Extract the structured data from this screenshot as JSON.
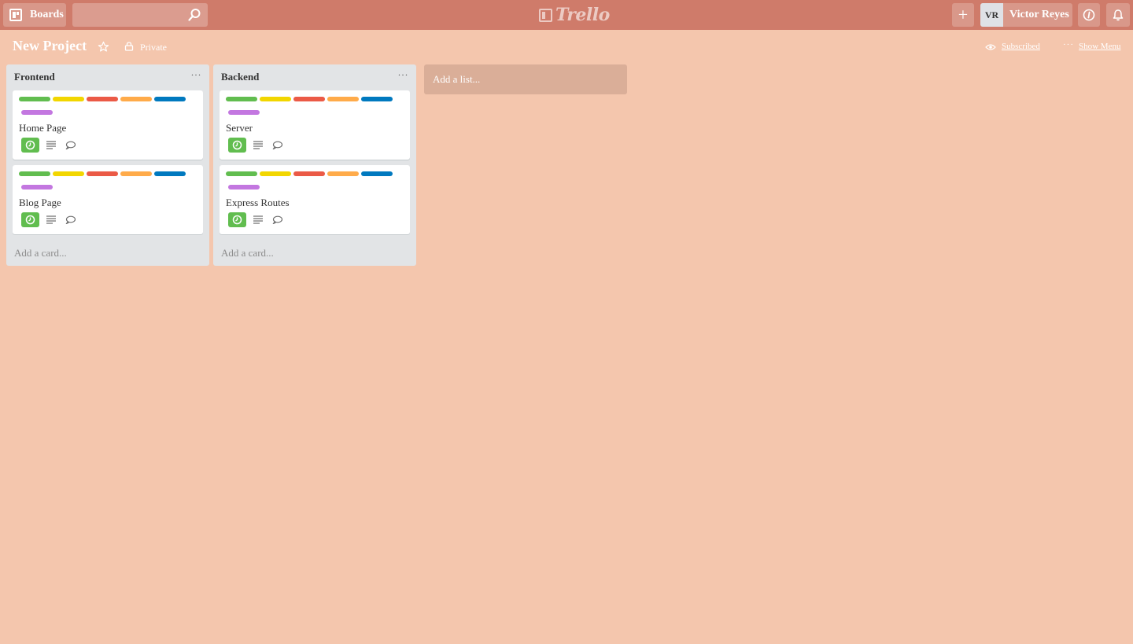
{
  "header": {
    "boards_label": "Boards",
    "search_placeholder": "",
    "logo_text": "Trello",
    "add_symbol": "+",
    "user_initials": "VR",
    "user_name": "Victor Reyes"
  },
  "board": {
    "title": "New Project",
    "privacy": "Private",
    "subscribed_label": "Subscribed",
    "menu_dots": "···",
    "show_menu_label": "Show Menu"
  },
  "colors": {
    "header_bg": "#cf7b6a",
    "board_bg": "#f4c6ad",
    "label_colors": [
      "#61bd4f",
      "#f2d600",
      "#eb5a46",
      "#ffab4a",
      "#0079bf",
      "#c377e0"
    ],
    "due_badge": "#61bd4f"
  },
  "lists": [
    {
      "title": "Frontend",
      "menu": "···",
      "cards": [
        {
          "title": "Home Page",
          "labels": [
            "green",
            "yellow",
            "red",
            "orange",
            "blue",
            "purple"
          ],
          "badges": [
            "clock-icon",
            "description-icon",
            "comment-icon"
          ]
        },
        {
          "title": "Blog Page",
          "labels": [
            "green",
            "yellow",
            "red",
            "orange",
            "blue",
            "purple"
          ],
          "badges": [
            "clock-icon",
            "description-icon",
            "comment-icon"
          ]
        }
      ],
      "add_card": "Add a card..."
    },
    {
      "title": "Backend",
      "menu": "···",
      "cards": [
        {
          "title": "Server",
          "labels": [
            "green",
            "yellow",
            "red",
            "orange",
            "blue",
            "purple"
          ],
          "badges": [
            "clock-icon",
            "description-icon",
            "comment-icon"
          ]
        },
        {
          "title": "Express Routes",
          "labels": [
            "green",
            "yellow",
            "red",
            "orange",
            "blue",
            "purple"
          ],
          "badges": [
            "clock-icon",
            "description-icon",
            "comment-icon"
          ]
        }
      ],
      "add_card": "Add a card..."
    }
  ],
  "add_list": "Add a list..."
}
